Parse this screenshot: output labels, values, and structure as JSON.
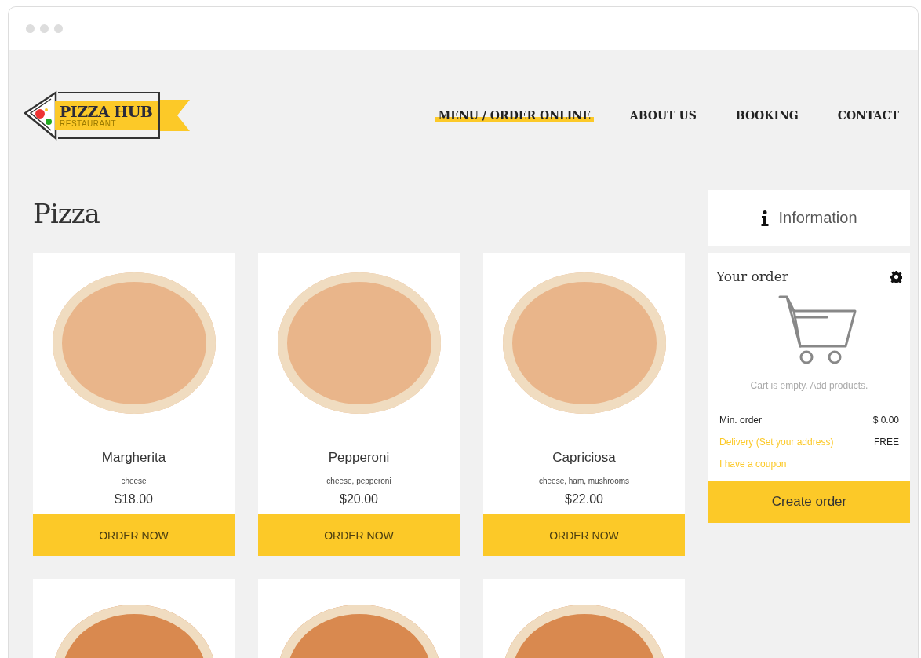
{
  "logo": {
    "name": "PIZZA HUB",
    "tagline": "RESTAURANT"
  },
  "nav": [
    {
      "label": "MENU / ORDER ONLINE",
      "selected": true
    },
    {
      "label": "ABOUT US",
      "selected": false
    },
    {
      "label": "BOOKING",
      "selected": false
    },
    {
      "label": "CONTACT",
      "selected": false
    }
  ],
  "section_title": "Pizza",
  "pizzas": [
    {
      "name": "Margherita",
      "ingredients": "cheese",
      "price": "$18.00",
      "button": "ORDER NOW"
    },
    {
      "name": "Pepperoni",
      "ingredients": "cheese, pepperoni",
      "price": "$20.00",
      "button": "ORDER NOW"
    },
    {
      "name": "Capriciosa",
      "ingredients": "cheese, ham, mushrooms",
      "price": "$22.00",
      "button": "ORDER NOW"
    }
  ],
  "sidebar": {
    "info_label": "Information",
    "order_title": "Your order",
    "empty_text": "Cart is empty. Add products.",
    "summary": [
      {
        "label": "Min. order",
        "value": "$ 0.00",
        "kind": "plain"
      },
      {
        "label": "Delivery (Set your address)",
        "value": "FREE",
        "kind": "link"
      },
      {
        "label": "I have a coupon",
        "kind": "link"
      }
    ],
    "button": "Create order"
  }
}
